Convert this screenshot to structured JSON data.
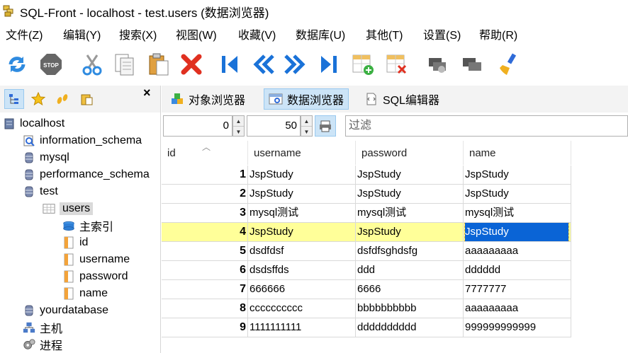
{
  "window": {
    "title": "SQL-Front - localhost - test.users  (数据浏览器)"
  },
  "menu": [
    "文件(Z)",
    "编辑(Y)",
    "搜索(X)",
    "视图(W)",
    "收藏(V)",
    "数据库(U)",
    "其他(T)",
    "设置(S)",
    "帮助(R)"
  ],
  "toolbar": {
    "buttons": [
      "refresh-icon",
      "stop-icon",
      "cut-icon",
      "copy-icon",
      "paste-icon",
      "delete-icon",
      "first-icon",
      "prev-icon",
      "next-icon",
      "last-icon",
      "insert-row-icon",
      "delete-row-icon",
      "cmd-icon",
      "cmd2-icon",
      "brush-icon"
    ],
    "stop_label": "STOP"
  },
  "left_pane": {
    "close": "×",
    "tree": [
      {
        "label": "localhost",
        "icon": "server-icon"
      },
      {
        "label": "information_schema",
        "icon": "db-search-icon"
      },
      {
        "label": "mysql",
        "icon": "database-icon"
      },
      {
        "label": "performance_schema",
        "icon": "database-icon"
      },
      {
        "label": "test",
        "icon": "database-icon"
      },
      {
        "label": "users",
        "icon": "table-icon",
        "selected": true
      },
      {
        "label": "主索引",
        "icon": "index-icon"
      },
      {
        "label": "id",
        "icon": "field-icon"
      },
      {
        "label": "username",
        "icon": "field-icon"
      },
      {
        "label": "password",
        "icon": "field-icon"
      },
      {
        "label": "name",
        "icon": "field-icon"
      },
      {
        "label": "yourdatabase",
        "icon": "database-icon"
      },
      {
        "label": "主机",
        "icon": "hosts-icon"
      },
      {
        "label": "进程",
        "icon": "process-icon"
      }
    ]
  },
  "tabs": [
    {
      "label": "对象浏览器",
      "active": false
    },
    {
      "label": "数据浏览器",
      "active": true
    },
    {
      "label": "SQL编辑器",
      "active": false
    }
  ],
  "filterbar": {
    "offset": "0",
    "limit": "50",
    "filter_placeholder": "过滤"
  },
  "grid": {
    "columns": [
      "id",
      "username",
      "password",
      "name"
    ],
    "rows": [
      [
        "1",
        "JspStudy",
        "JspStudy",
        "JspStudy"
      ],
      [
        "2",
        "JspStudy",
        "JspStudy",
        "JspStudy"
      ],
      [
        "3",
        "mysql测试",
        "mysql测试",
        "mysql测试"
      ],
      [
        "4",
        "JspStudy",
        "JspStudy",
        "JspStudy"
      ],
      [
        "5",
        "dsdfdsf",
        "dsfdfsghdsfg",
        "aaaaaaaaa"
      ],
      [
        "6",
        "dsdsffds",
        "ddd",
        "dddddd"
      ],
      [
        "7",
        "666666",
        "6666",
        "7777777"
      ],
      [
        "8",
        "cccccccccc",
        "bbbbbbbbbb",
        "aaaaaaaaa"
      ],
      [
        "9",
        "1111111111",
        "dddddddddd",
        "999999999999"
      ]
    ],
    "highlighted_row": 3,
    "colors": {
      "highlight": "#ffff99",
      "selection": "#0a64d6"
    }
  }
}
